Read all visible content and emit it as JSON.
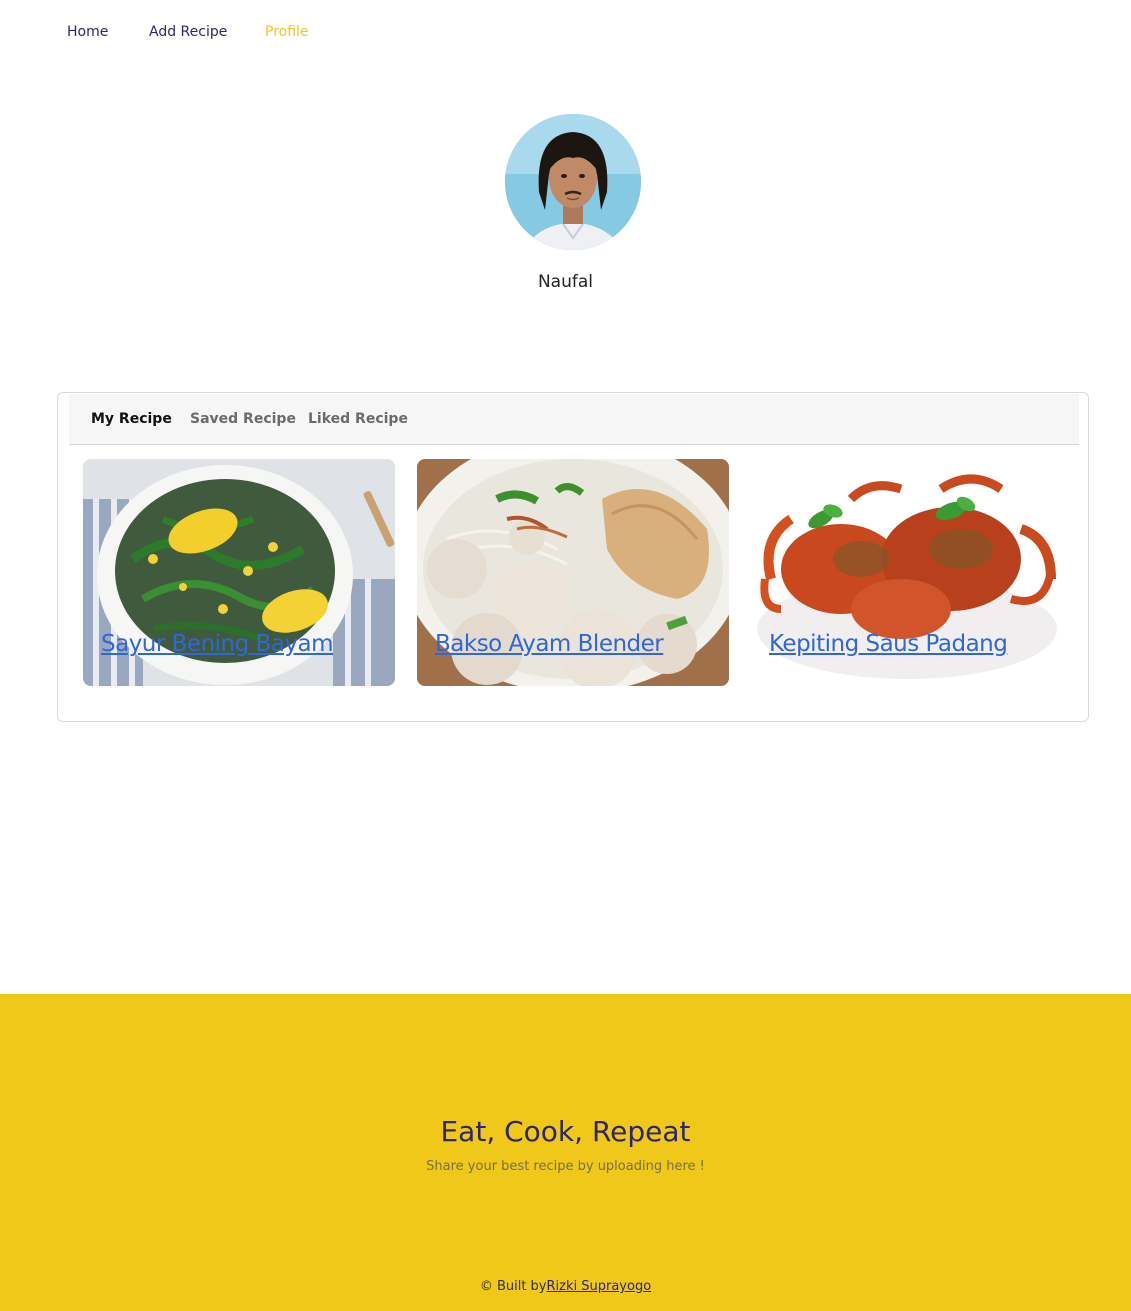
{
  "nav": {
    "home": "Home",
    "add_recipe": "Add Recipe",
    "profile": "Profile",
    "active_color": "#efc81a"
  },
  "profile": {
    "username": "Naufal"
  },
  "tabs": [
    {
      "label": "My Recipe",
      "active": true
    },
    {
      "label": "Saved Recipe",
      "active": false
    },
    {
      "label": "Liked Recipe",
      "active": false
    }
  ],
  "recipes": [
    {
      "title": "Sayur Bening Bayam"
    },
    {
      "title": "Bakso Ayam Blender"
    },
    {
      "title": "Kepiting Saus Padang"
    }
  ],
  "footer": {
    "tagline": "Eat, Cook, Repeat",
    "subtitle": "Share your best recipe by uploading here !",
    "credit_prefix": "© Built by",
    "credit_author": "Rizki Suprayogo",
    "background": "#efc81a"
  }
}
